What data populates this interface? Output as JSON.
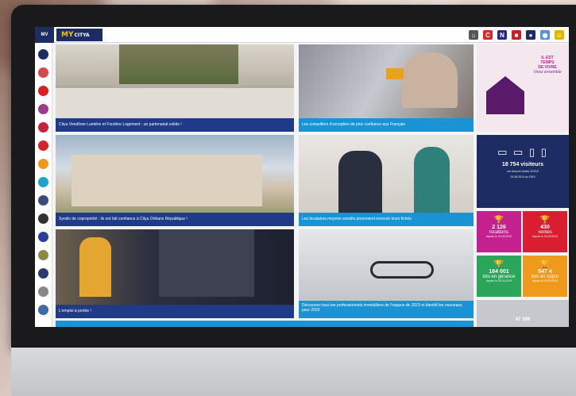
{
  "app": {
    "short_label": "MV",
    "logo_prefix": "MY",
    "logo_suffix": "CITYA"
  },
  "top_icons": [
    {
      "icon": "home-icon",
      "glyph": "⌂",
      "color": "#555555"
    },
    {
      "icon": "brand-c-icon",
      "glyph": "C",
      "color": "#d32a2a"
    },
    {
      "icon": "brand-n-icon",
      "glyph": "N",
      "color": "#2a2a86"
    },
    {
      "icon": "red-square-icon",
      "glyph": "■",
      "color": "#c81e2a"
    },
    {
      "icon": "globe-icon",
      "glyph": "●",
      "color": "#1d2c63"
    },
    {
      "icon": "world-icon",
      "glyph": "◉",
      "color": "#5a8fd0"
    },
    {
      "icon": "smiley-icon",
      "glyph": "☺",
      "color": "#e6b400"
    }
  ],
  "sidebar_icons": [
    {
      "name": "home-shield-icon",
      "color": "#1d2c63"
    },
    {
      "name": "chart-icon",
      "color": "#d34a4a"
    },
    {
      "name": "play-icon",
      "color": "#d82020"
    },
    {
      "name": "pen-icon",
      "color": "#9a3b8b"
    },
    {
      "name": "mail-icon",
      "color": "#c9203b"
    },
    {
      "name": "bell-icon",
      "color": "#d42525"
    },
    {
      "name": "star-icon",
      "color": "#f09a1d"
    },
    {
      "name": "info-icon",
      "color": "#19a6c8"
    },
    {
      "name": "hat-icon",
      "color": "#3a4a7a"
    },
    {
      "name": "camera-icon",
      "color": "#333333"
    },
    {
      "name": "book-icon",
      "color": "#2a3f9a"
    },
    {
      "name": "key-icon",
      "color": "#8a8a40"
    },
    {
      "name": "user-icon",
      "color": "#2a3a6a"
    },
    {
      "name": "doc-icon",
      "color": "#888888"
    },
    {
      "name": "gear-icon",
      "color": "#3a6aa8"
    }
  ],
  "tiles": [
    {
      "caption": "Citya Vendôme Lumière et Fondère Logement : un partenariat solide !",
      "style": "blue",
      "bg": "#a6a29a"
    },
    {
      "caption": "Les conseillers d'exception de plus confiance aux Français",
      "style": "cyan",
      "bg": "#9a9ea4"
    },
    {
      "caption": "Syndic de copropriété : ils ont fait confiance à Citya Orléans République !",
      "style": "blue",
      "bg": "#c7bfae"
    },
    {
      "caption": "Les locataires moyens sondés pourvoient recevoir leurs fichés",
      "style": "cyan",
      "bg": "#d8d6d2"
    },
    {
      "caption": "L'emploi à portée !",
      "style": "blue",
      "bg": "#3b3f52"
    },
    {
      "caption": "Découvrez tous les professionnels immobiliers de l'espace de 2019 et bientôt les nouveaux pour 2020",
      "style": "cyan",
      "bg": "#c3c6cc"
    }
  ],
  "promo": {
    "headline_1": "IL EST",
    "headline_2": "TEMPS",
    "headline_3": "DE VIVRE",
    "tagline": "Vivez ensemble"
  },
  "visitors": {
    "count": "18 754 visiteurs",
    "line_1": "ont réservé visites 3/2019",
    "line_2": "25.08.2019 au 2019"
  },
  "stats": [
    {
      "value": "2 126",
      "label": "locations",
      "sub": "depuis le 01/01/2019",
      "bg": "#c4208e"
    },
    {
      "value": "430",
      "label": "ventes",
      "sub": "depuis le 01/01/2019",
      "bg": "#d81e30"
    },
    {
      "value": "164 001",
      "label": "lots en gérance",
      "sub": "depuis le 01/01/2019",
      "bg": "#2aa55a"
    },
    {
      "value": "547 4",
      "label": "lots en copro",
      "sub": "depuis le 01/01/2019",
      "bg": "#f09a1d"
    }
  ],
  "footer_stat": {
    "value": "47 399"
  }
}
